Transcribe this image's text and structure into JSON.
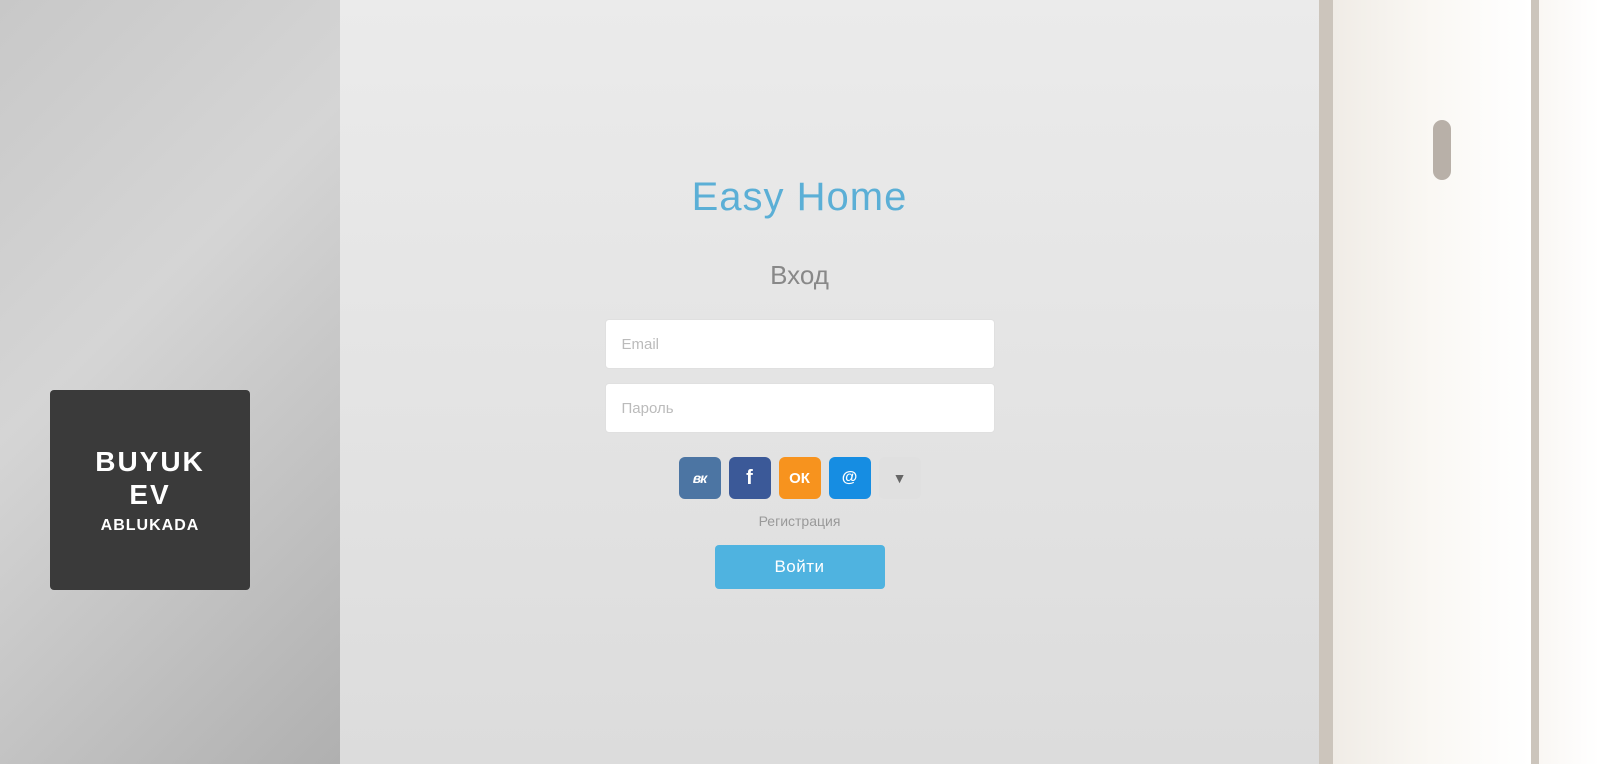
{
  "app": {
    "title": "Easy Home"
  },
  "login": {
    "heading": "Вход",
    "email_placeholder": "Email",
    "password_placeholder": "Пароль",
    "register_label": "Регистрация",
    "login_button_label": "Войти"
  },
  "social": [
    {
      "name": "vk",
      "label": "ВК",
      "color": "#4c75a3",
      "icon": "vk-icon"
    },
    {
      "name": "facebook",
      "label": "f",
      "color": "#3b5998",
      "icon": "facebook-icon"
    },
    {
      "name": "odnoklassniki",
      "label": "ОК",
      "color": "#f7931e",
      "icon": "ok-icon"
    },
    {
      "name": "mailru",
      "label": "@",
      "color": "#168de2",
      "icon": "mailru-icon"
    },
    {
      "name": "yandex",
      "label": "▼",
      "color": "#e6e6e6",
      "icon": "yandex-icon"
    }
  ],
  "background": {
    "left_sign_line1": "BUYUK",
    "left_sign_line2": "EV",
    "left_sign_line3": "ABLUKADA"
  },
  "colors": {
    "title": "#5bafd6",
    "heading": "#888888",
    "button_bg": "#4fb3e0",
    "button_text": "#ffffff",
    "register_link": "#999999"
  }
}
